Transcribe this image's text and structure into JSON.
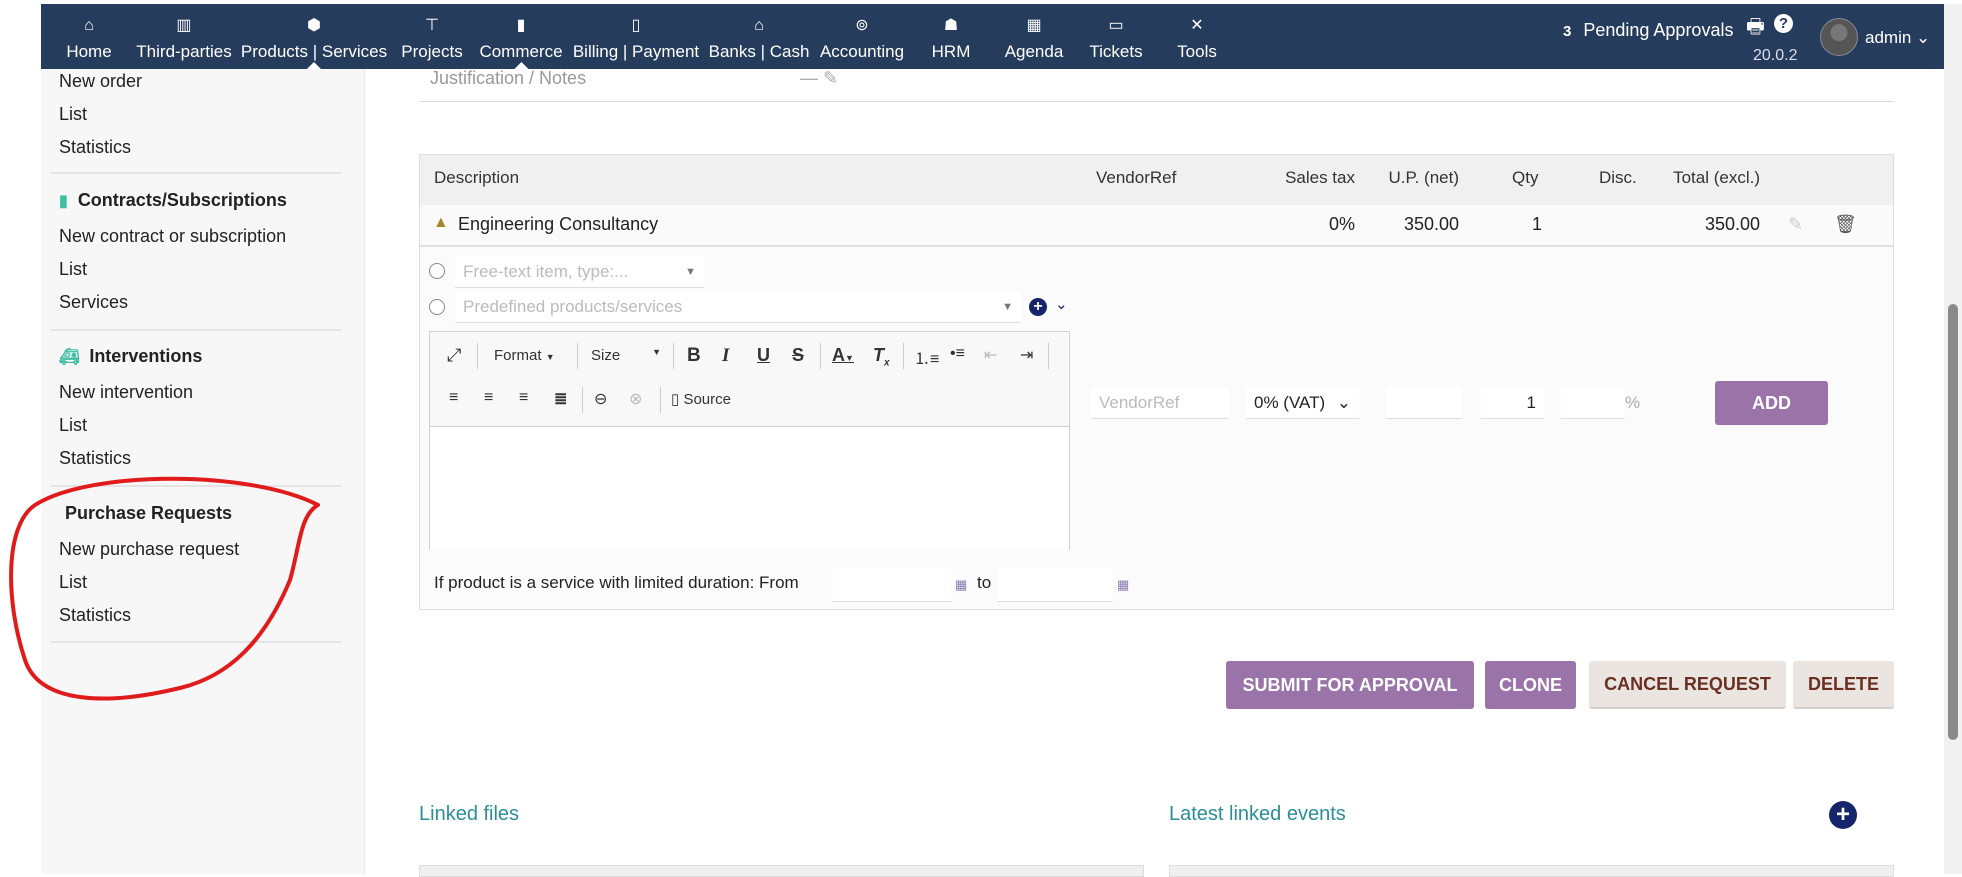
{
  "nav": {
    "items": [
      {
        "label": "Home",
        "icon": "home-icon",
        "glyph": "⌂"
      },
      {
        "label": "Third-parties",
        "icon": "building-icon",
        "glyph": "▥"
      },
      {
        "label": "Products | Services",
        "icon": "cube-icon",
        "glyph": "⬢"
      },
      {
        "label": "Projects",
        "icon": "sitemap-icon",
        "glyph": "⊤"
      },
      {
        "label": "Commerce",
        "icon": "suitcase-icon",
        "glyph": "▮"
      },
      {
        "label": "Billing | Payment",
        "icon": "invoice-icon",
        "glyph": "▯"
      },
      {
        "label": "Banks | Cash",
        "icon": "bank-icon",
        "glyph": "⌂"
      },
      {
        "label": "Accounting",
        "icon": "search-dollar-icon",
        "glyph": "⊚"
      },
      {
        "label": "HRM",
        "icon": "user-tie-icon",
        "glyph": "☗"
      },
      {
        "label": "Agenda",
        "icon": "calendar-icon",
        "glyph": "▦"
      },
      {
        "label": "Tickets",
        "icon": "ticket-icon",
        "glyph": "▭"
      },
      {
        "label": "Tools",
        "icon": "tools-icon",
        "glyph": "✕"
      }
    ],
    "pending_count": "3",
    "pending_label": "Pending Approvals",
    "version": "20.0.2",
    "user": "admin"
  },
  "sidebar": {
    "top": [
      "New order",
      "List",
      "Statistics"
    ],
    "contracts": {
      "title": "Contracts/Subscriptions",
      "items": [
        "New contract or subscription",
        "List",
        "Services"
      ]
    },
    "interventions": {
      "title": "Interventions",
      "items": [
        "New intervention",
        "List",
        "Statistics"
      ]
    },
    "purchase": {
      "title": "Purchase Requests",
      "items": [
        "New purchase request",
        "List",
        "Statistics"
      ]
    }
  },
  "form": {
    "justification_label": "Justification / Notes",
    "justification_value": "—"
  },
  "table": {
    "headers": [
      "Description",
      "VendorRef",
      "Sales tax",
      "U.P. (net)",
      "Qty",
      "Disc.",
      "Total (excl.)"
    ],
    "row": {
      "description": "Engineering Consultancy",
      "vendor_ref": "",
      "sales_tax": "0%",
      "unit_price": "350.00",
      "qty": "1",
      "disc": "",
      "total": "350.00"
    }
  },
  "add_line": {
    "free_text_placeholder": "Free-text item, type:...",
    "predefined_placeholder": "Predefined products/services",
    "editor": {
      "format": "Format",
      "size": "Size",
      "source": "Source"
    },
    "vendorref_placeholder": "VendorRef",
    "vat": "0% (VAT)",
    "qty": "1",
    "percent": "%",
    "add": "ADD",
    "duration_label": "If product is a service with limited duration: From",
    "to_label": "to"
  },
  "actions": {
    "submit": "SUBMIT FOR APPROVAL",
    "clone": "CLONE",
    "cancel": "CANCEL REQUEST",
    "delete": "DELETE"
  },
  "sections": {
    "linked_files": "Linked files",
    "linked_events": "Latest linked events"
  },
  "colors": {
    "nav": "#263c5c",
    "primary_button": "#9a73a8",
    "teal": "#2a8f96",
    "annotation": "#e01b1b"
  }
}
